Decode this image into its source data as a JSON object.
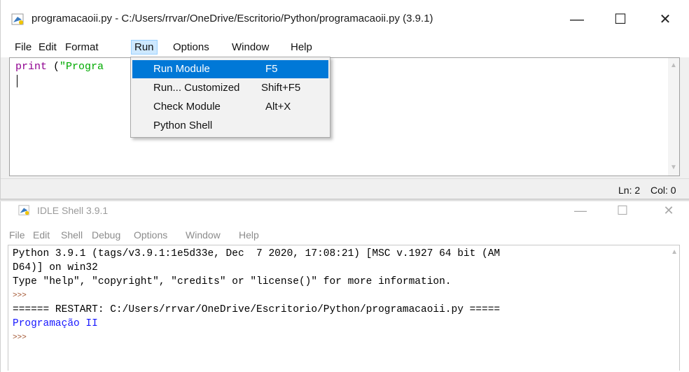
{
  "editor": {
    "title": "programacaoii.py - C:/Users/rrvar/OneDrive/Escritorio/Python/programacaoii.py (3.9.1)",
    "window_buttons": {
      "minimize": "—",
      "maximize": "☐",
      "close": "✕"
    },
    "menu": [
      "File",
      "Edit",
      "Format",
      "Run",
      "Options",
      "Window",
      "Help"
    ],
    "active_menu": "Run",
    "code": {
      "builtin": "print",
      "rest_prefix": " (",
      "string": "\"Progra"
    },
    "status": {
      "ln": "Ln: 2",
      "col": "Col: 0"
    },
    "run_menu": [
      {
        "label": "Run Module",
        "accel": "F5",
        "selected": true
      },
      {
        "label": "Run... Customized",
        "accel": "Shift+F5",
        "selected": false
      },
      {
        "label": "Check Module",
        "accel": "Alt+X",
        "selected": false
      },
      {
        "label": "Python Shell",
        "accel": "",
        "selected": false
      }
    ]
  },
  "shell": {
    "title": "IDLE Shell 3.9.1",
    "window_buttons": {
      "minimize": "—",
      "maximize": "☐",
      "close": "✕"
    },
    "menu": [
      "File",
      "Edit",
      "Shell",
      "Debug",
      "Options",
      "Window",
      "Help"
    ],
    "lines": {
      "l1": "Python 3.9.1 (tags/v3.9.1:1e5d33e, Dec  7 2020, 17:08:21) [MSC v.1927 64 bit (AM",
      "l2": "D64)] on win32",
      "l3": "Type \"help\", \"copyright\", \"credits\" or \"license()\" for more information.",
      "prompt": ">>>",
      "restart": "====== RESTART: C:/Users/rrvar/OneDrive/Escritorio/Python/programacaoii.py =====",
      "output": "Programação II"
    }
  },
  "icons": {
    "app": "python-idle-icon",
    "scroll_up": "scroll-up-arrow-icon",
    "scroll_down": "scroll-down-arrow-icon"
  },
  "colors": {
    "menu_selected": "#0078d7",
    "builtin": "#900090",
    "string": "#00aa00",
    "output": "#1919ff",
    "prompt": "#a0522d"
  }
}
